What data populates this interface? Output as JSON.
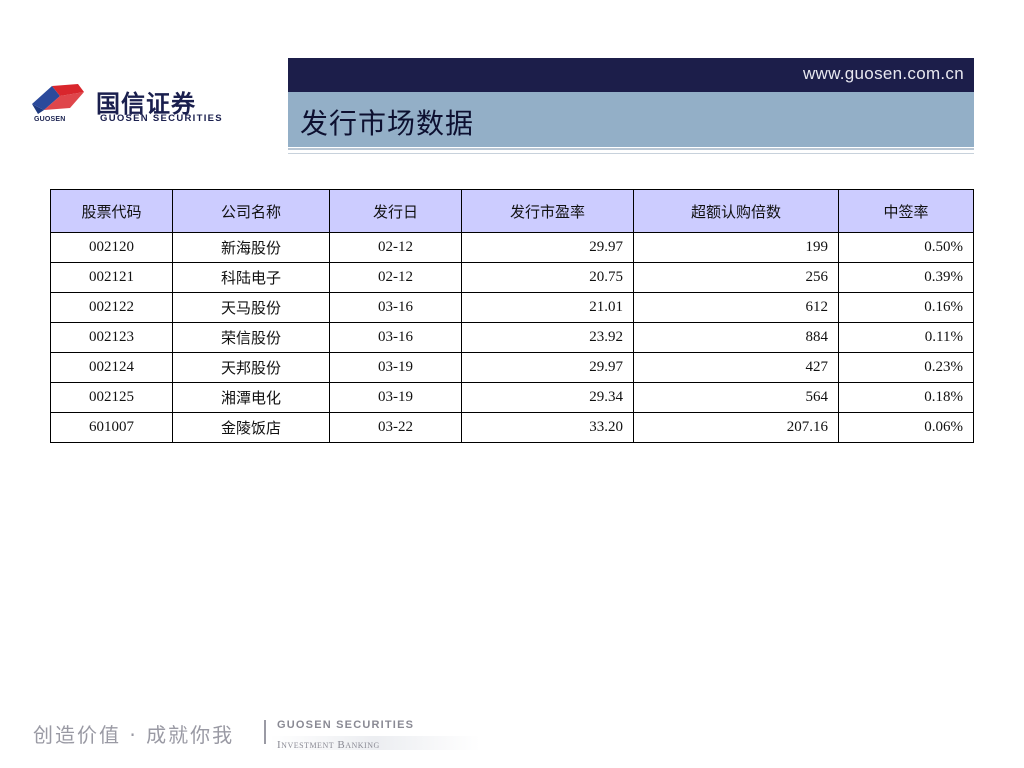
{
  "logo": {
    "mark_text": "GUOSEN",
    "name_cn": "国信证券",
    "name_en": "GUOSEN SECURITIES",
    "colors": {
      "red": "#d9262c",
      "blue": "#2b4a9b",
      "navy": "#1a1f4e"
    }
  },
  "header": {
    "url": "www.guosen.com.cn",
    "title": "发行市场数据",
    "colors": {
      "top_bar": "#1c1e4a",
      "title_bar": "#93afc7"
    }
  },
  "table": {
    "header_color": "#ccccff",
    "columns": [
      "股票代码",
      "公司名称",
      "发行日",
      "发行市盈率",
      "超额认购倍数",
      "中签率"
    ],
    "rows": [
      [
        "002120",
        "新海股份",
        "02-12",
        "29.97",
        "199",
        "0.50%"
      ],
      [
        "002121",
        "科陆电子",
        "02-12",
        "20.75",
        "256",
        "0.39%"
      ],
      [
        "002122",
        "天马股份",
        "03-16",
        "21.01",
        "612",
        "0.16%"
      ],
      [
        "002123",
        "荣信股份",
        "03-16",
        "23.92",
        "884",
        "0.11%"
      ],
      [
        "002124",
        "天邦股份",
        "03-19",
        "29.97",
        "427",
        "0.23%"
      ],
      [
        "002125",
        "湘潭电化",
        "03-19",
        "29.34",
        "564",
        "0.18%"
      ],
      [
        "601007",
        "金陵饭店",
        "03-22",
        "33.20",
        "207.16",
        "0.06%"
      ]
    ]
  },
  "footer": {
    "slogan": "创造价值 · 成就你我",
    "company_en": "GUOSEN SECURITIES",
    "division": "Investment Banking"
  }
}
